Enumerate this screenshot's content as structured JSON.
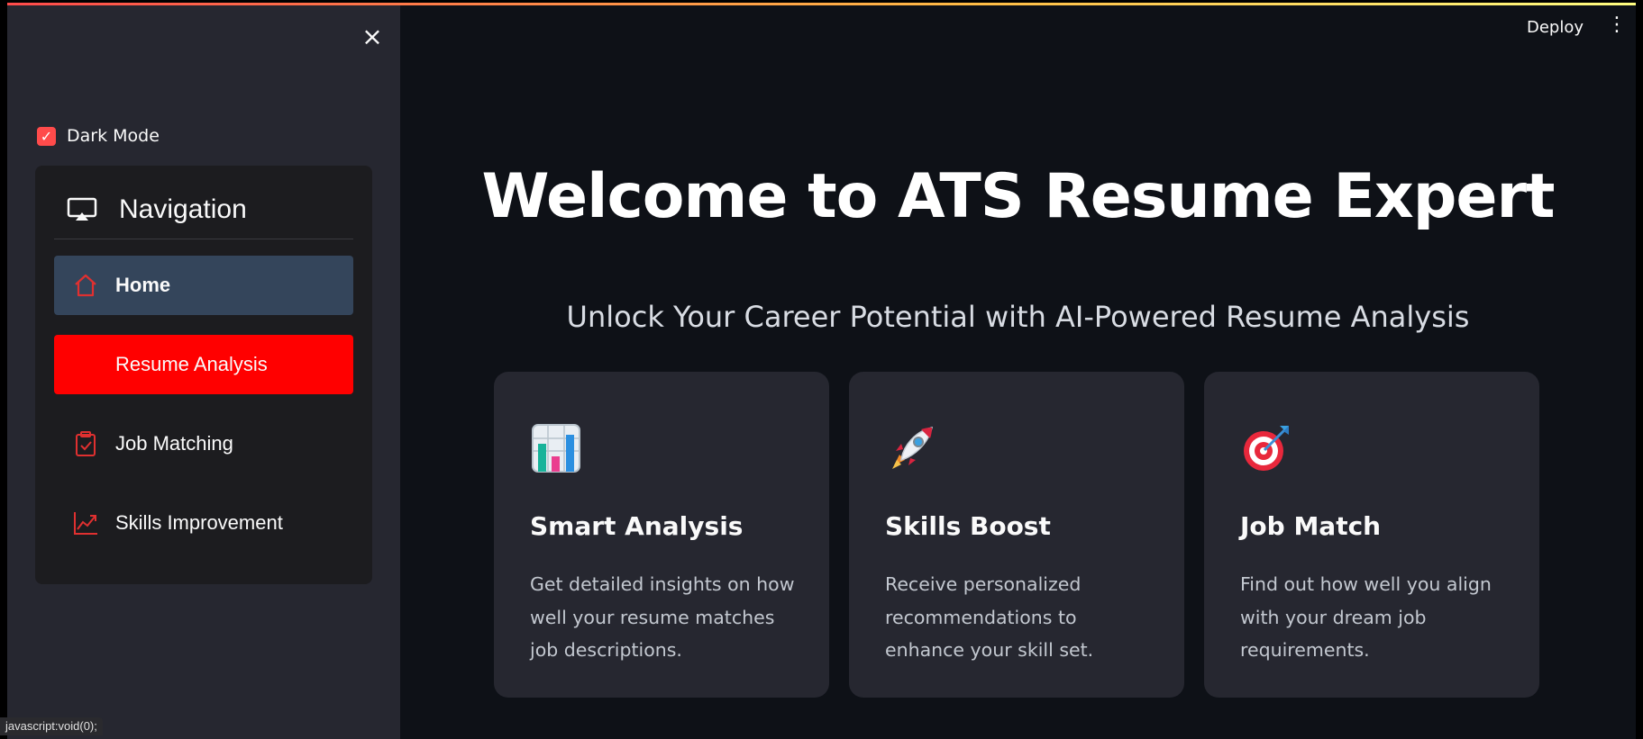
{
  "header": {
    "deploy_label": "Deploy",
    "menu_icon": "more-vertical-icon"
  },
  "sidebar": {
    "close_glyph": "×",
    "dark_mode": {
      "label": "Dark Mode",
      "checked": true
    },
    "navigation": {
      "title": "Navigation",
      "items": [
        {
          "label": "Home",
          "icon": "home-icon",
          "state": "selected"
        },
        {
          "label": "Resume Analysis",
          "icon": "chart-icon",
          "state": "hovered"
        },
        {
          "label": "Job Matching",
          "icon": "clipboard-check-icon",
          "state": "normal"
        },
        {
          "label": "Skills Improvement",
          "icon": "trending-up-icon",
          "state": "normal"
        }
      ]
    }
  },
  "main": {
    "title": "Welcome to ATS Resume Expert",
    "subtitle": "Unlock Your Career Potential with AI-Powered Resume Analysis",
    "cards": [
      {
        "title": "Smart Analysis",
        "description": "Get detailed insights on how well your resume matches job descriptions.",
        "icon": "bar-chart-emoji"
      },
      {
        "title": "Skills Boost",
        "description": "Receive personalized recommendations to enhance your skill set.",
        "icon": "rocket-emoji"
      },
      {
        "title": "Job Match",
        "description": "Find out how well you align with your dream job requirements.",
        "icon": "target-emoji"
      }
    ]
  },
  "statusbar": {
    "text": "javascript:void(0);"
  },
  "colors": {
    "background": "#0e1117",
    "sidebar": "#262730",
    "accent": "#ff4b4b",
    "active_nav": "#34455b",
    "hover_nav": "#ff0000",
    "card": "#262730"
  }
}
